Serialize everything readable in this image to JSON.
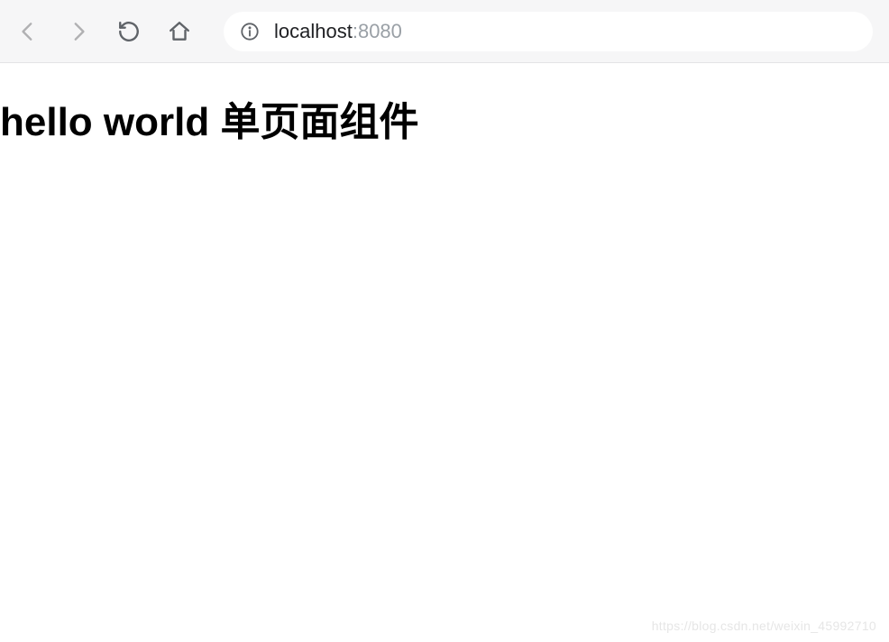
{
  "browser": {
    "url_host": "localhost",
    "url_port": ":8080"
  },
  "page": {
    "heading": "hello world 单页面组件"
  },
  "watermark": "https://blog.csdn.net/weixin_45992710"
}
